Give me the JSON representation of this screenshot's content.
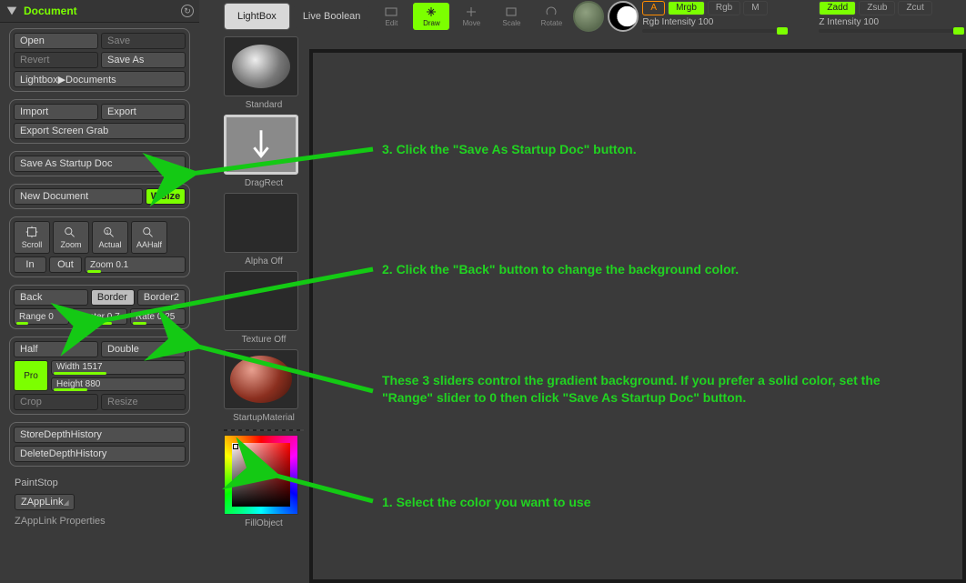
{
  "panel": {
    "title": "Document",
    "open": "Open",
    "save": "Save",
    "revert": "Revert",
    "saveAs": "Save As",
    "lightboxDocs": "Lightbox▶Documents",
    "import": "Import",
    "export": "Export",
    "esg": "Export Screen Grab",
    "saveStartup": "Save As Startup Doc",
    "newDoc": "New Document",
    "wsize": "WSize",
    "scroll": "Scroll",
    "zoom": "Zoom",
    "actual": "Actual",
    "aahalf": "AAHalf",
    "in": "In",
    "out": "Out",
    "zoomLbl": "Zoom 0.1",
    "back": "Back",
    "border": "Border",
    "border2": "Border2",
    "range": "Range 0",
    "center": "Center 0.7",
    "rate": "Rate 0.25",
    "half": "Half",
    "double": "Double",
    "pro": "Pro",
    "width": "Width 1517",
    "height": "Height 880",
    "crop": "Crop",
    "resize": "Resize",
    "store": "StoreDepthHistory",
    "del": "DeleteDepthHistory",
    "paintstop": "PaintStop",
    "zapplink": "ZAppLink",
    "zapplinkProps": "ZAppLink Properties"
  },
  "rail": {
    "standard": "Standard",
    "dragrect": "DragRect",
    "alphaOff": "Alpha Off",
    "textureOff": "Texture Off",
    "startupMat": "StartupMaterial",
    "fillObj": "FillObject"
  },
  "top": {
    "lightbox": "LightBox",
    "liveBool": "Live Boolean",
    "edit": "Edit",
    "draw": "Draw",
    "move": "Move",
    "scale": "Scale",
    "rotate": "Rotate",
    "a": "A",
    "mrgb": "Mrgb",
    "rgb": "Rgb",
    "m": "M",
    "rgbInt": "Rgb Intensity 100",
    "zadd": "Zadd",
    "zsub": "Zsub",
    "zcut": "Zcut",
    "zInt": "Z Intensity 100"
  },
  "anno": {
    "a1": "1. Select the color you want to use",
    "a2": "2. Click the \"Back\" button to change the background color.",
    "a3": "3. Click the \"Save As Startup Doc\" button.",
    "a4": "These 3 sliders control the gradient background. If you prefer a solid color, set the \"Range\" slider to 0 then click \"Save As Startup Doc\" button."
  }
}
